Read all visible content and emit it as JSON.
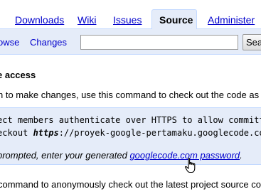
{
  "tabs": {
    "downloads": "Downloads",
    "wiki": "Wiki",
    "issues": "Issues",
    "source": "Source",
    "administer": "Administer"
  },
  "subnav": {
    "browse": "owse",
    "changes": "Changes",
    "search_value": "",
    "search_button": "Sea"
  },
  "section": {
    "heading": "e access",
    "instruction": "n to make changes, use this command to check out the code as"
  },
  "code": {
    "line1": "ect members authenticate over HTTPS to allow committi",
    "line2_prefix": "eckout ",
    "line2_https": "https",
    "line2_rest": "://proyek-google-pertamaku.googlecode.co",
    "prompt_text": "prompted, enter your generated ",
    "prompt_link": "googlecode.com password",
    "prompt_end": "."
  },
  "footer": {
    "text": "command to anonymously check out the latest project source co"
  },
  "colors": {
    "link": "#0000cc",
    "panel": "#e5ecf9",
    "border": "#c3d9ff"
  }
}
